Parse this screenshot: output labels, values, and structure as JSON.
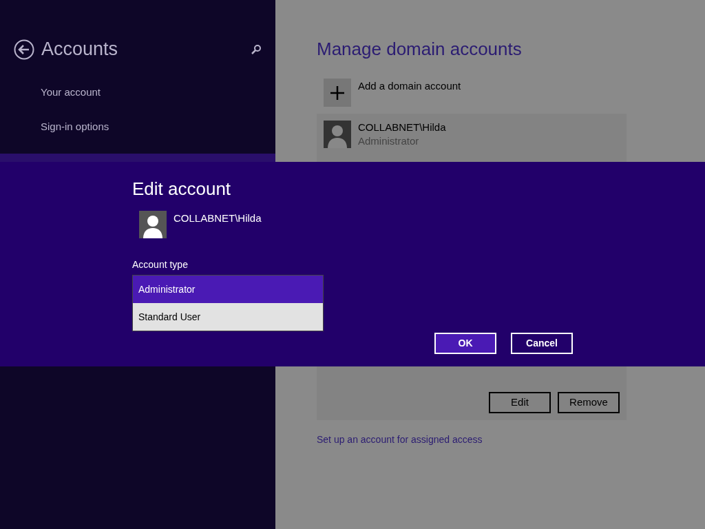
{
  "sidebar": {
    "title": "Accounts",
    "items": [
      {
        "label": "Your account",
        "selected": false
      },
      {
        "label": "Sign-in options",
        "selected": false
      },
      {
        "selected": true
      }
    ]
  },
  "main": {
    "title": "Manage domain accounts",
    "add_label": "Add a domain account",
    "accounts": [
      {
        "name": "COLLABNET\\Hilda",
        "role": "Administrator"
      }
    ],
    "buttons": [
      "Edit",
      "Remove"
    ],
    "link": "Set up an account for assigned access"
  },
  "dialog": {
    "title": "Edit account",
    "account_name": "COLLABNET\\Hilda",
    "field_label": "Account type",
    "options": [
      {
        "label": "Administrator",
        "selected": true
      },
      {
        "label": "Standard User",
        "selected": false
      }
    ],
    "buttons": [
      {
        "label": "OK",
        "kind": "primary"
      },
      {
        "label": "Cancel",
        "kind": "secondary"
      }
    ]
  }
}
